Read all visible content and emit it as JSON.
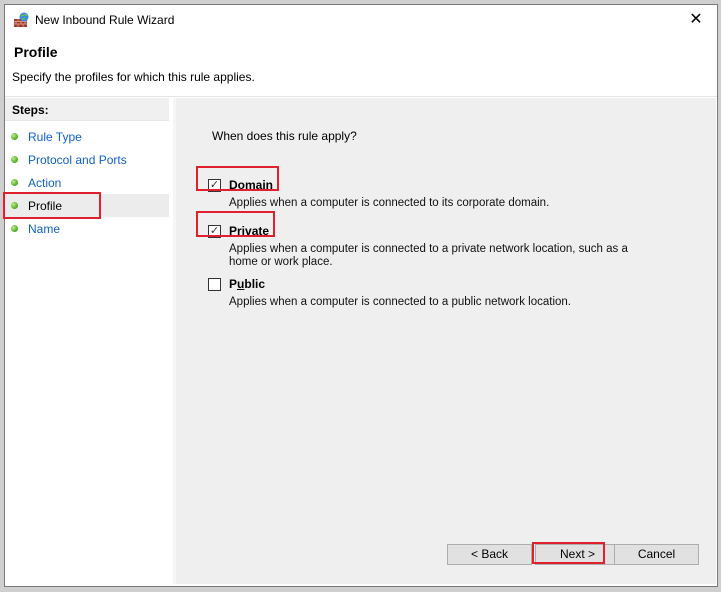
{
  "window": {
    "title": "New Inbound Rule Wizard",
    "app_icon": "firewall-icon",
    "close_label": "✕"
  },
  "header": {
    "title": "Profile",
    "subtitle": "Specify the profiles for which this rule applies."
  },
  "steps": {
    "heading": "Steps:",
    "items": [
      {
        "label": "Rule Type",
        "active": false
      },
      {
        "label": "Protocol and Ports",
        "active": false
      },
      {
        "label": "Action",
        "active": false
      },
      {
        "label": "Profile",
        "active": true
      },
      {
        "label": "Name",
        "active": false
      }
    ]
  },
  "main": {
    "question": "When does this rule apply?",
    "options": [
      {
        "label": "Domain",
        "mnemonic": "D",
        "checked": true,
        "check_glyph": "✓",
        "description": "Applies when a computer is connected to its corporate domain."
      },
      {
        "label": "Private",
        "mnemonic": "P",
        "checked": true,
        "check_glyph": "✓",
        "description": "Applies when a computer is connected to a private network location, such as a home or work place."
      },
      {
        "label": "Public",
        "mnemonic": "u",
        "checked": false,
        "check_glyph": "",
        "description": "Applies when a computer is connected to a public network location."
      }
    ]
  },
  "buttons": {
    "back": "< Back",
    "next": "Next >",
    "cancel": "Cancel"
  },
  "colors": {
    "highlight": "#e0202c",
    "link": "#1060c0",
    "step_dot": "#4aa81c"
  }
}
